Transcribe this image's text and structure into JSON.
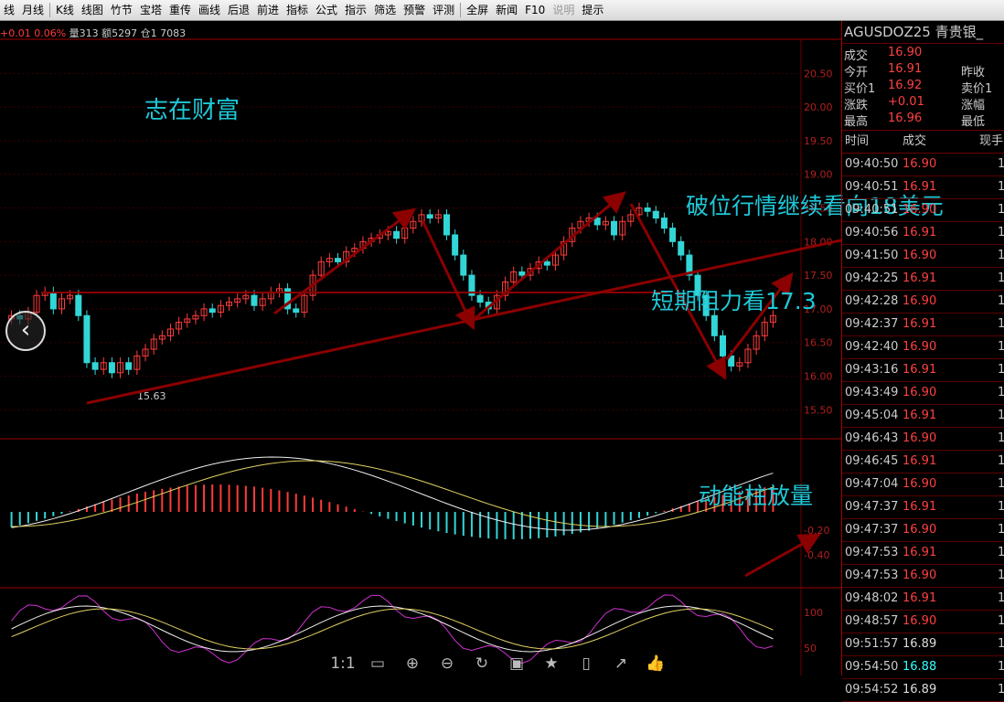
{
  "toolbar": {
    "items": [
      "线",
      "月线",
      "K线",
      "线图",
      "竹节",
      "宝塔",
      "重传",
      "画线",
      "后退",
      "前进",
      "指标",
      "公式",
      "指示",
      "筛选",
      "预警",
      "评测",
      "全屏",
      "新闻",
      "F10",
      "说明",
      "提示"
    ]
  },
  "infobar": {
    "change": "+0.01",
    "pct": "0.06%",
    "vol": "量313",
    "amount": "额5297",
    "oi": "仓1 7083"
  },
  "symbol": {
    "title": "AGUSDOZ25  青贵银_"
  },
  "quote": {
    "rows": [
      {
        "label": "成交",
        "value": "16.90",
        "label2": "",
        "value2": ""
      },
      {
        "label": "今开",
        "value": "16.91",
        "label2": "昨收",
        "value2": ""
      },
      {
        "label": "买价1",
        "value": "16.92",
        "label2": "卖价1",
        "value2": ""
      },
      {
        "label": "涨跌",
        "value": "+0.01",
        "label2": "涨幅",
        "value2": ""
      },
      {
        "label": "最高",
        "value": "16.96",
        "label2": "最低",
        "value2": ""
      }
    ]
  },
  "ticks_header": {
    "time": "时间",
    "price": "成交",
    "hand": "现手"
  },
  "ticks": [
    {
      "time": "09:40:50",
      "price": "16.90",
      "color": "red"
    },
    {
      "time": "09:40:51",
      "price": "16.91",
      "color": "red"
    },
    {
      "time": "09:40:51",
      "price": "16.90",
      "color": "red"
    },
    {
      "time": "09:40:56",
      "price": "16.91",
      "color": "red"
    },
    {
      "time": "09:41:50",
      "price": "16.90",
      "color": "red"
    },
    {
      "time": "09:42:25",
      "price": "16.91",
      "color": "red"
    },
    {
      "time": "09:42:28",
      "price": "16.90",
      "color": "red"
    },
    {
      "time": "09:42:37",
      "price": "16.91",
      "color": "red"
    },
    {
      "time": "09:42:40",
      "price": "16.90",
      "color": "red"
    },
    {
      "time": "09:43:16",
      "price": "16.91",
      "color": "red"
    },
    {
      "time": "09:43:49",
      "price": "16.90",
      "color": "red"
    },
    {
      "time": "09:45:04",
      "price": "16.91",
      "color": "red"
    },
    {
      "time": "09:46:43",
      "price": "16.90",
      "color": "red"
    },
    {
      "time": "09:46:45",
      "price": "16.91",
      "color": "red"
    },
    {
      "time": "09:47:04",
      "price": "16.90",
      "color": "red"
    },
    {
      "time": "09:47:37",
      "price": "16.91",
      "color": "red"
    },
    {
      "time": "09:47:37",
      "price": "16.90",
      "color": "red"
    },
    {
      "time": "09:47:53",
      "price": "16.91",
      "color": "red"
    },
    {
      "time": "09:47:53",
      "price": "16.90",
      "color": "red"
    },
    {
      "time": "09:48:02",
      "price": "16.91",
      "color": "red"
    },
    {
      "time": "09:48:57",
      "price": "16.90",
      "color": "red"
    },
    {
      "time": "09:51:57",
      "price": "16.89",
      "color": "white"
    },
    {
      "time": "09:54:50",
      "price": "16.88",
      "color": "cyan"
    },
    {
      "time": "09:54:52",
      "price": "16.89",
      "color": "white"
    }
  ],
  "price_axis": [
    "20.50",
    "20.00",
    "19.50",
    "19.00",
    "18.50",
    "18.00",
    "17.50",
    "17.00",
    "16.50",
    "16.00",
    "15.50"
  ],
  "macd_axis": [
    "-0.20",
    "-0.40"
  ],
  "kdj_axis": [
    "100",
    "50"
  ],
  "low_label": "15.63",
  "annotations": {
    "watermark": "志在财富",
    "breakout": "破位行情继续看向18美元",
    "resistance": "短期阻力看17.3",
    "momentum": "动能柱放量"
  },
  "colors": {
    "up": "#ff3b3b",
    "down": "#33d6d6",
    "arrow": "#8b0000",
    "grid": "#6a0000",
    "annotation": "#1ec8d8"
  },
  "chart_data": {
    "type": "candlestick",
    "ylim": [
      15.3,
      20.6
    ],
    "closes": [
      16.9,
      16.85,
      16.95,
      17.2,
      17.25,
      17.0,
      17.15,
      17.2,
      16.9,
      16.2,
      16.1,
      16.2,
      16.05,
      16.2,
      16.1,
      16.3,
      16.4,
      16.55,
      16.6,
      16.7,
      16.8,
      16.85,
      16.9,
      17.0,
      16.95,
      17.05,
      17.1,
      17.15,
      17.2,
      17.05,
      17.15,
      17.25,
      17.3,
      17.0,
      16.95,
      17.2,
      17.5,
      17.7,
      17.75,
      17.7,
      17.85,
      17.9,
      18.0,
      18.05,
      18.1,
      18.15,
      18.05,
      18.2,
      18.3,
      18.4,
      18.35,
      18.4,
      18.1,
      17.8,
      17.5,
      17.2,
      17.1,
      17.0,
      17.2,
      17.4,
      17.55,
      17.5,
      17.6,
      17.7,
      17.65,
      17.8,
      18.0,
      18.2,
      18.3,
      18.35,
      18.25,
      18.3,
      18.1,
      18.3,
      18.4,
      18.5,
      18.45,
      18.35,
      18.2,
      18.0,
      17.8,
      17.5,
      17.2,
      16.9,
      16.6,
      16.3,
      16.15,
      16.2,
      16.4,
      16.6,
      16.8,
      16.9
    ]
  }
}
